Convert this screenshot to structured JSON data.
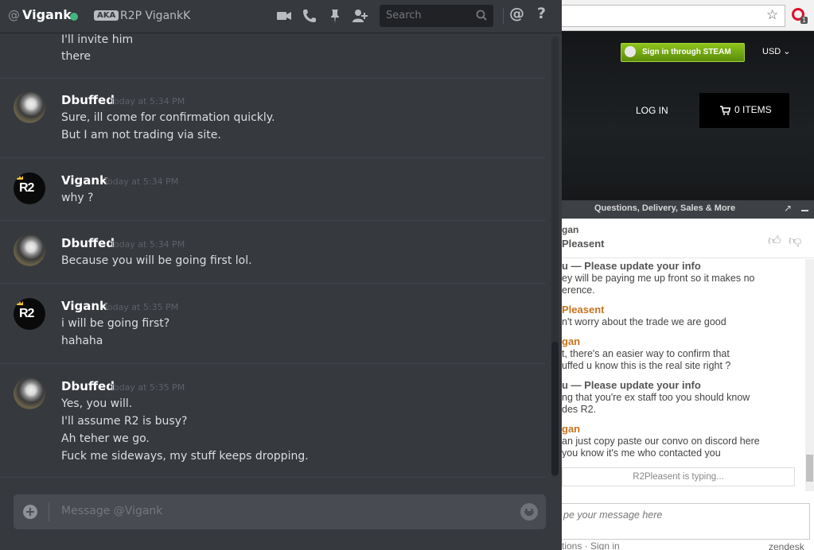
{
  "colors": {
    "discord_bg": "#36393e",
    "status_online": "#43b581",
    "zendesk_orange": "#c8731e",
    "zendesk_username": "#555555"
  },
  "header": {
    "at_symbol": "@",
    "dm_name": "Vigank",
    "aka_badge": "AKA",
    "nickname": "R2P VigankK",
    "search_placeholder": "Search",
    "mention_symbol": "@",
    "help_symbol": "?"
  },
  "messages": [
    {
      "lines": [
        "I'll invite him",
        "there"
      ]
    },
    {
      "author": "Dbuffed",
      "timestamp": "Today at 5:34 PM",
      "avatar": "dbuffed",
      "lines": [
        "Sure, ill come for confirmation quickly.",
        "But I am not trading via site."
      ]
    },
    {
      "author": "Vigank",
      "timestamp": "Today at 5:34 PM",
      "avatar": "r2",
      "avatar_text": "R2",
      "lines": [
        "why ?"
      ]
    },
    {
      "author": "Dbuffed",
      "timestamp": "Today at 5:34 PM",
      "avatar": "dbuffed",
      "lines": [
        "Because you will be going first lol."
      ]
    },
    {
      "author": "Vigank",
      "timestamp": "Today at 5:35 PM",
      "avatar": "r2",
      "avatar_text": "R2",
      "lines": [
        "i will be going first?",
        "hahaha"
      ]
    },
    {
      "author": "Dbuffed",
      "timestamp": "Today at 5:35 PM",
      "avatar": "dbuffed",
      "lines": [
        "Yes, you will.",
        "I'll assume R2 is busy?",
        "Ah teher we go.",
        "Fuck me sideways, my stuff keeps dropping."
      ]
    }
  ],
  "composer": {
    "placeholder": "Message @Vigank"
  },
  "browser": {
    "steam_button": "Sign in through STEAM",
    "currency": "USD",
    "login": "LOG IN",
    "cart": "0 ITEMS",
    "opera_badge": "1"
  },
  "zendesk": {
    "title": "Questions, Delivery, Sales & More",
    "agent_role": "gan",
    "agent_name": "Pleasent",
    "chat": [
      {
        "name": "u — Please update your info",
        "color": "#555555",
        "lines": [
          "ey will be paying me up front so it makes no",
          "erence."
        ]
      },
      {
        "name": "Pleasent",
        "color": "#c8731e",
        "lines": [
          "n't worry about the trade we are good"
        ]
      },
      {
        "name": "gan",
        "color": "#c8731e",
        "lines": [
          "t, there's an easier way to confirm that",
          "uffed u know this is the real site right ?"
        ]
      },
      {
        "name": "u — Please update your info",
        "color": "#555555",
        "lines": [
          "ng that you're ex staff too you should know",
          "des R2."
        ]
      },
      {
        "name": "gan",
        "color": "#c8731e",
        "lines": [
          "an just copy paste our convo on discord here",
          "you know it's me who contacted you"
        ]
      }
    ],
    "typing": "R2Pleasent is typing...",
    "input_placeholder": "pe your message here",
    "footer": "tions · Sign in",
    "brand": "zendesk"
  }
}
